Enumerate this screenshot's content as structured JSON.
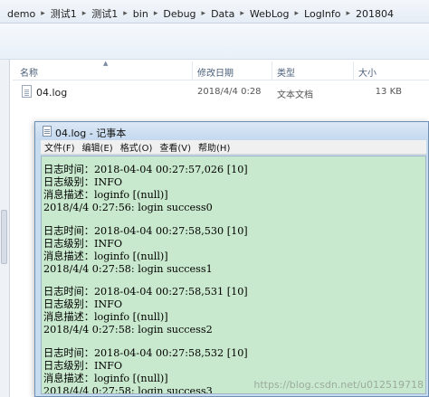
{
  "explorer": {
    "breadcrumbs": [
      "demo",
      "测试1",
      "测试1",
      "bin",
      "Debug",
      "Data",
      "WebLog",
      "LogInfo",
      "201804"
    ],
    "columns": {
      "name": "名称",
      "modified": "修改日期",
      "type": "类型",
      "size": "大小"
    },
    "files": [
      {
        "name": "04.log",
        "modified": "2018/4/4 0:28",
        "type": "文本文档",
        "size": "13 KB"
      }
    ]
  },
  "notepad": {
    "title": "04.log - 记事本",
    "menu": [
      "文件(F)",
      "编辑(E)",
      "格式(O)",
      "查看(V)",
      "帮助(H)"
    ],
    "entries": [
      {
        "time": "日志时间：2018-04-04 00:27:57,026 [10]",
        "level": "日志级别：INFO",
        "desc": "消息描述：loginfo [(null)]",
        "msg": "2018/4/4 0:27:56: login success0"
      },
      {
        "time": "日志时间：2018-04-04 00:27:58,530 [10]",
        "level": "日志级别：INFO",
        "desc": "消息描述：loginfo [(null)]",
        "msg": "2018/4/4 0:27:58: login success1"
      },
      {
        "time": "日志时间：2018-04-04 00:27:58,531 [10]",
        "level": "日志级别：INFO",
        "desc": "消息描述：loginfo [(null)]",
        "msg": "2018/4/4 0:27:58: login success2"
      },
      {
        "time": "日志时间：2018-04-04 00:27:58,532 [10]",
        "level": "日志级别：INFO",
        "desc": "消息描述：loginfo [(null)]",
        "msg": "2018/4/4 0:27:58: login success3"
      }
    ]
  },
  "watermark": "https://blog.csdn.net/u012519718",
  "icons": {
    "file": "text-file-icon",
    "notepad": "notepad-icon",
    "separator": "chevron-right-icon"
  },
  "colors": {
    "notepad_bg": "#c8e9cd",
    "title_bg": "#c8dcf0"
  }
}
